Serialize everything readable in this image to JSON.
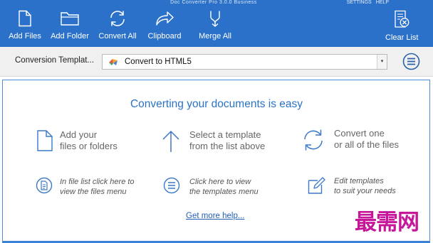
{
  "app": {
    "title": "Doc Converter Pro 3.0.0 Business",
    "menu": [
      "SETTINGS",
      "HELP"
    ]
  },
  "toolbar": [
    {
      "id": "add-files",
      "label": "Add Files",
      "icon": "file-icon"
    },
    {
      "id": "add-folder",
      "label": "Add Folder",
      "icon": "folder-icon"
    },
    {
      "id": "convert-all",
      "label": "Convert All",
      "icon": "refresh-icon"
    },
    {
      "id": "clipboard",
      "label": "Clipboard",
      "icon": "share-arrow-icon"
    },
    {
      "id": "merge-all",
      "label": "Merge All",
      "icon": "merge-icon"
    },
    {
      "id": "clear-list",
      "label": "Clear List",
      "icon": "clear-list-icon"
    }
  ],
  "template_bar": {
    "label": "Conversion  Templat...",
    "selected_template": "Convert to HTML5",
    "dropdown_arrow": "▾"
  },
  "main": {
    "headline": "Converting your documents is easy",
    "steps": [
      {
        "text": "Add your\nfiles or folders",
        "icon": "file-icon"
      },
      {
        "text": "Select a template\nfrom the list above",
        "icon": "arrow-up-icon"
      },
      {
        "text": "Convert one\nor all of the files",
        "icon": "refresh-icon"
      }
    ],
    "hints": [
      {
        "text": "In file list click here to\nview the files menu",
        "icon": "file-menu-icon"
      },
      {
        "text": "Click here to view\nthe templates menu",
        "icon": "menu-icon"
      },
      {
        "text": "Edit templates\nto suit your needs",
        "icon": "edit-icon"
      }
    ],
    "help_link": "Get more help..."
  },
  "watermark": "最需网",
  "colors": {
    "ribbon": "#2b71c9",
    "accent": "#2a72c8",
    "watermark": "#c6179b"
  }
}
